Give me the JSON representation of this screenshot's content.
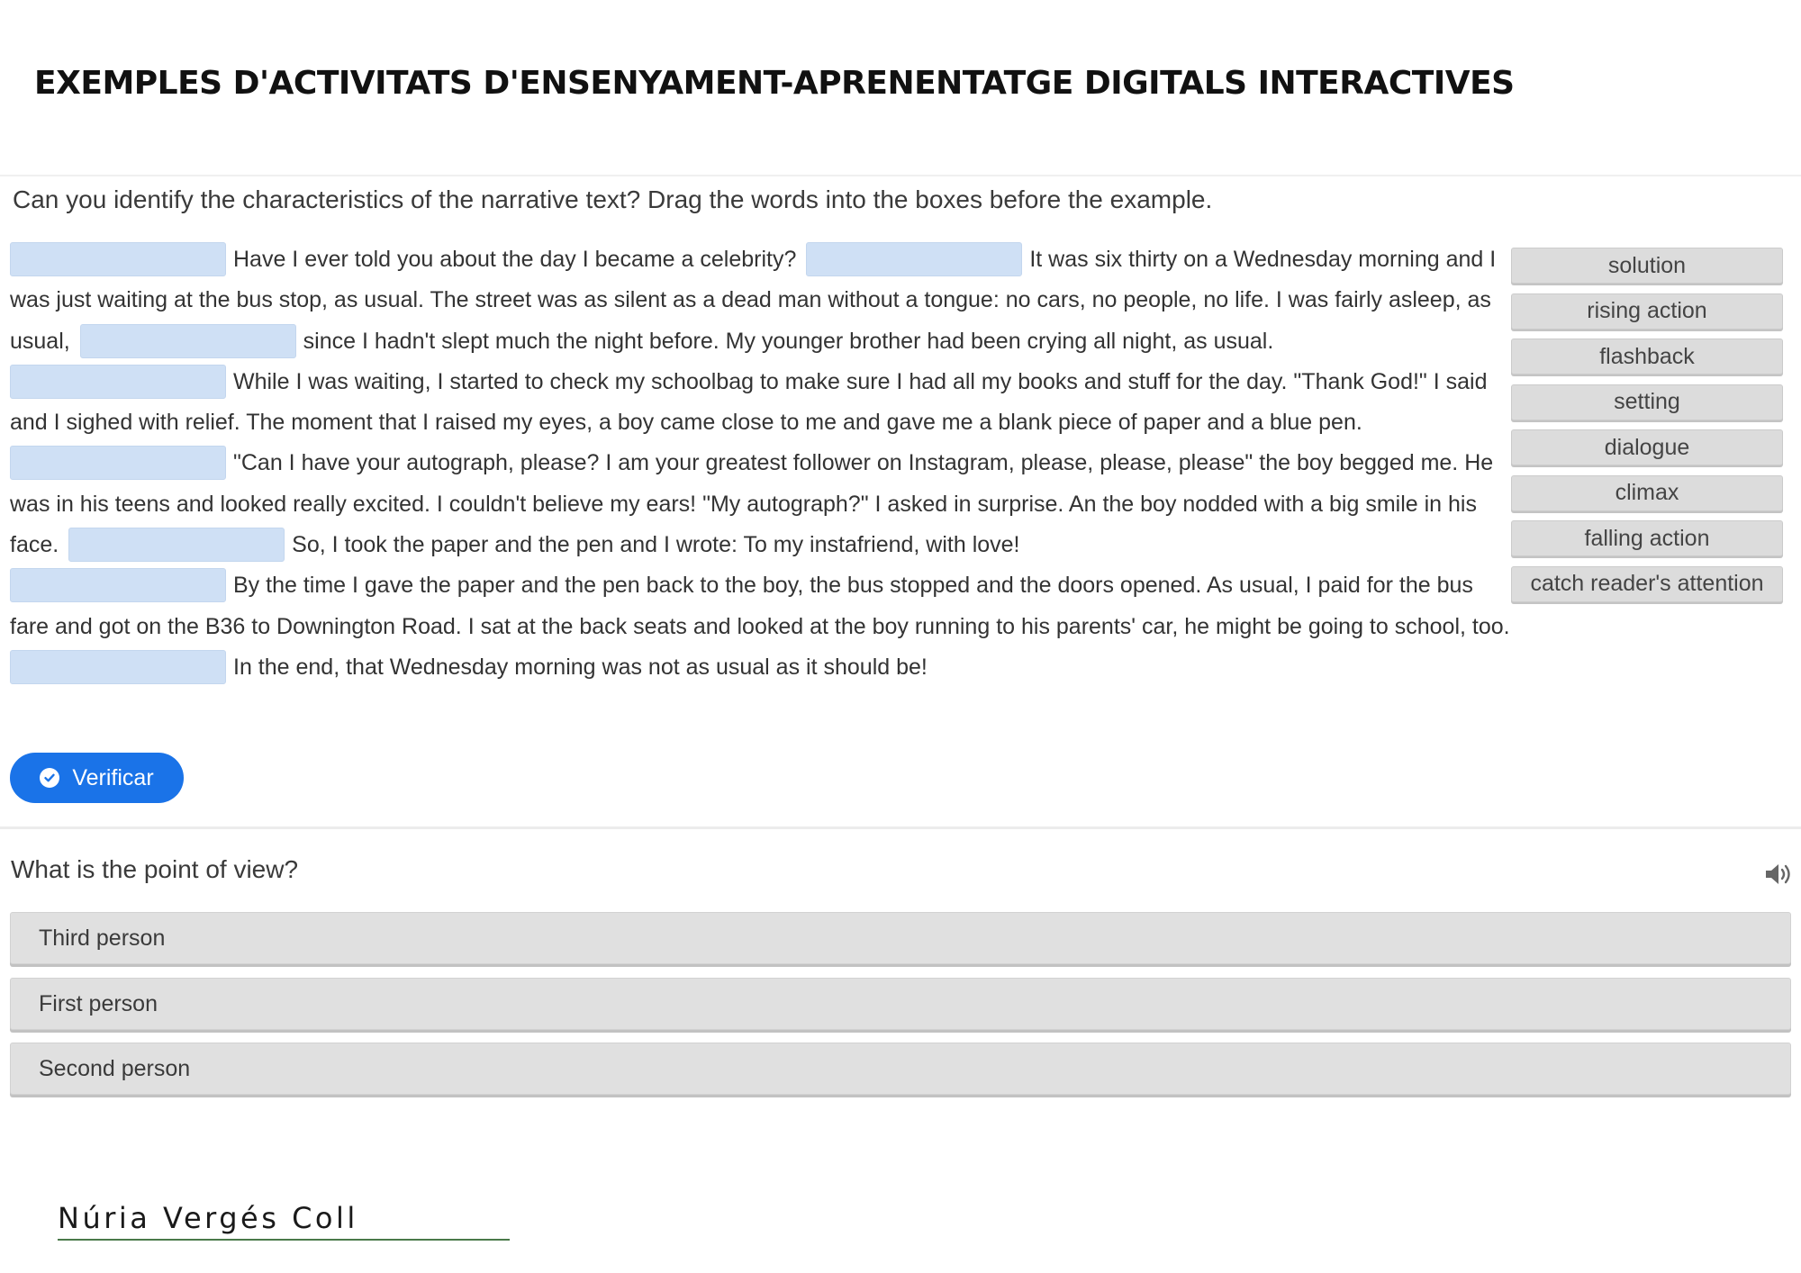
{
  "header": {
    "title": "EXEMPLES D'ACTIVITATS D'ENSENYAMENT-APRENENTATGE DIGITALS INTERACTIVES"
  },
  "activity": {
    "instructions": "Can you identify the characteristics of the narrative text? Drag the words into the boxes before the example.",
    "segments": [
      "Have I ever told you about the day I became a celebrity?",
      "It was six thirty on a Wednesday morning and I was just waiting at the bus stop, as usual. The street was as silent as a dead man without a tongue: no cars, no people, no life. I was fairly asleep, as usual,",
      "since I hadn't slept much the night before. My younger brother had been crying all night, as usual.",
      "While I was waiting, I started to check my schoolbag to make sure I had all my books and stuff for the day. \"Thank God!\" I said and I sighed with relief. The moment that I raised my eyes, a boy came close to me and gave me a blank piece of paper and a blue pen.",
      "\"Can I have your autograph, please? I am your greatest follower on Instagram, please, please, please\" the boy begged me. He was in his teens and looked really excited. I couldn't believe my ears! \"My autograph?\" I asked in surprise. An the boy nodded with a big smile in his face.",
      "So, I took the paper and the pen and I wrote: To my instafriend, with love!",
      "By the time I gave the paper and the pen back to the boy, the bus stopped and the doors opened. As usual, I paid for the bus fare and got on the B36 to Downington Road. I sat at the back seats and looked at the boy running to his parents' car, he might be going to school, too.",
      "In the end, that Wednesday morning was not as usual as it should be!"
    ],
    "word_bank": [
      "solution",
      "rising action",
      "flashback",
      "setting",
      "dialogue",
      "climax",
      "falling action",
      "catch reader's attention"
    ],
    "verify_label": "Verificar",
    "accent_color": "#1a73e8",
    "drop_zone_color": "#cfe0f5"
  },
  "quiz": {
    "question": "What is the point of view?",
    "options": [
      "Third person",
      "First person",
      "Second person"
    ]
  },
  "footer": {
    "author": "Núria Vergés Coll"
  }
}
